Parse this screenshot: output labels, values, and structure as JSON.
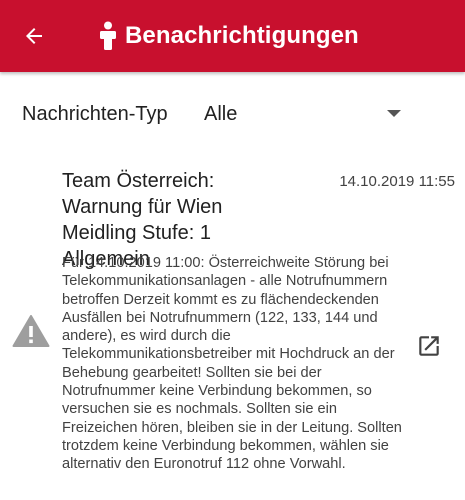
{
  "appbar": {
    "title": "Benachrichtigungen",
    "background_color": "#c8102e",
    "back_icon": "arrow-left-icon",
    "title_icon": "person-info-icon"
  },
  "filter": {
    "label": "Nachrichten-Typ",
    "selected": "Alle"
  },
  "message": {
    "title": "Team Österreich:  Warnung für Wien Meidling Stufe: 1 Allgemein",
    "date": "14.10.2019 11:55",
    "severity_icon": "warning-icon",
    "open_icon": "open-in-new-icon",
    "body": "Für 14.10.2019 11:00: Österreichweite Störung bei Telekommunikationsanlagen - alle Notrufnummern betroffen Derzeit kommt es zu flächendeckenden Ausfällen bei Notrufnummern (122, 133, 144 und andere), es wird durch die Telekommunikationsbetreiber mit Hochdruck an der Behebung gearbeitet! Sollten sie bei der Notrufnummer keine Verbindung bekommen, so versuchen sie es nochmals. Sollten sie ein Freizeichen hören, bleiben sie in der Leitung. Sollten trotzdem keine Verbindung bekommen, wählen sie alternativ den Euronotruf 112 ohne Vorwahl."
  }
}
